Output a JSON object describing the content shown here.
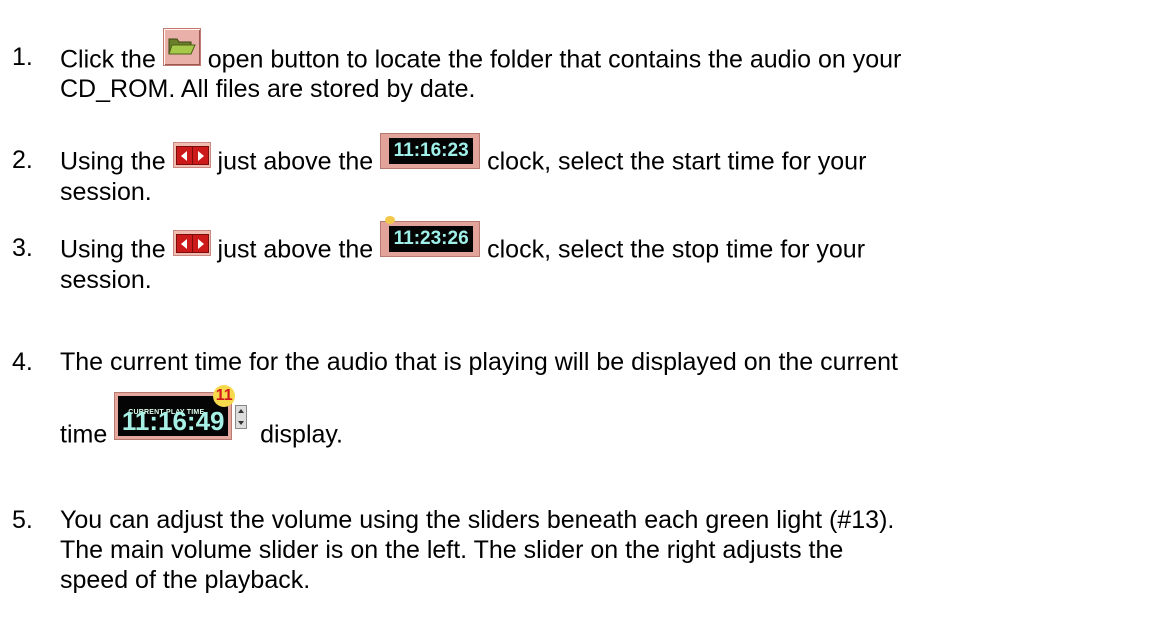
{
  "steps": [
    {
      "number": "1.",
      "line1_before": "Click the",
      "line1_after": "open button to locate the folder that contains the audio on your",
      "line2": "CD_ROM.  All files are stored by date."
    },
    {
      "number": "2.",
      "line1_a": "Using the",
      "line1_b": "just above the",
      "clock": "11:16:23",
      "line1_c": "clock, select the start time for your",
      "line2": "session."
    },
    {
      "number": "3.",
      "line1_a": "Using the",
      "line1_b": "just above the",
      "clock": "11:23:26",
      "line1_c": "clock, select the stop time for your",
      "line2": "session."
    },
    {
      "number": "4.",
      "line1": "The current time for the audio that is playing will be displayed on the current",
      "line2_a": "time",
      "display_label": "CURRENT PLAY TIME",
      "display_time": "11:16:49",
      "display_badge": "11",
      "line2_b": "display."
    },
    {
      "number": "5.",
      "line1": "You can adjust the volume using the sliders beneath each green light (#13).",
      "line2": "The main volume slider is on the left.  The slider on the right adjusts the",
      "line3": "speed of the playback."
    }
  ],
  "icons": {
    "open": "open-folder-icon",
    "arrows": "left-right-arrows-icon"
  },
  "colors": {
    "button_bg": "#e8b0a8",
    "clock_text": "#9ff0e8",
    "badge": "#f7d94c"
  }
}
